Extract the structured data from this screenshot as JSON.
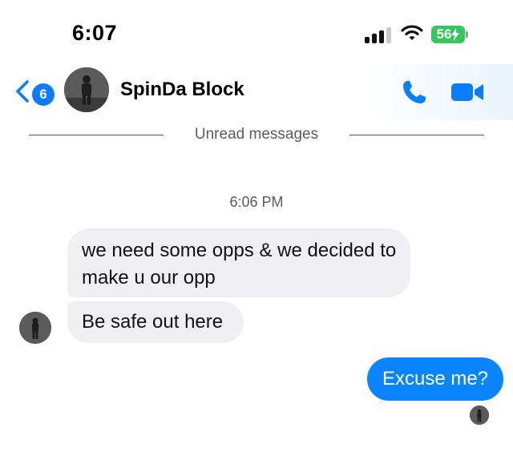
{
  "status_bar": {
    "time": "6:07",
    "battery": "56",
    "signal_bars_active": 3,
    "signal_bars_total": 4
  },
  "header": {
    "unread_count": "6",
    "contact_name": "SpinDa Block",
    "icons": [
      "back-chevron-icon",
      "phone-icon",
      "video-camera-icon"
    ],
    "accent_color": "#0a7cff"
  },
  "divider": {
    "label": "Unread messages"
  },
  "conversation": {
    "timestamp": "6:06 PM",
    "messages": [
      {
        "direction": "incoming",
        "text": "we need some opps & we decided to make u our opp"
      },
      {
        "direction": "incoming",
        "text": "Be safe out here"
      },
      {
        "direction": "outgoing",
        "text": "Excuse me?"
      }
    ],
    "outgoing_bubble_color": "#0a84ff",
    "incoming_bubble_color": "#f0f0f2"
  }
}
